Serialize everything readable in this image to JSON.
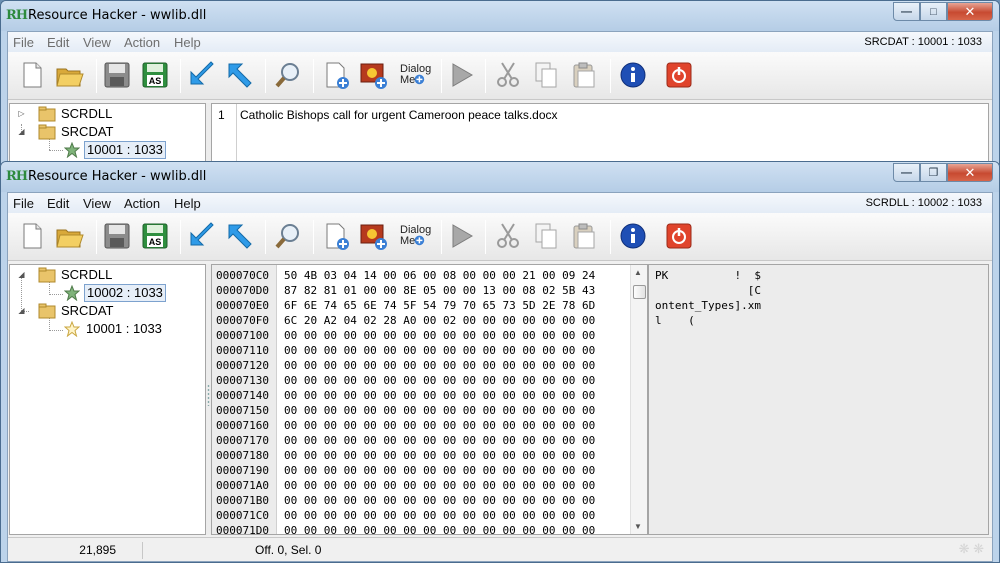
{
  "back_window": {
    "title": "Resource Hacker - wwlib.dll",
    "app_icon": "RH",
    "menus": [
      "File",
      "Edit",
      "View",
      "Action",
      "Help"
    ],
    "selection_status": "SRCDAT : 10001 : 1033",
    "tree": {
      "nodes": [
        {
          "label": "SCRDLL"
        },
        {
          "label": "SRCDAT"
        },
        {
          "label": "10001 : 1033"
        }
      ]
    },
    "editor": {
      "line_number": "1",
      "line_text": "Catholic Bishops call for urgent Cameroon peace talks.docx"
    }
  },
  "front_window": {
    "title": "Resource Hacker - wwlib.dll",
    "app_icon": "RH",
    "menus": [
      "File",
      "Edit",
      "View",
      "Action",
      "Help"
    ],
    "selection_status": "SCRDLL : 10002 : 1033",
    "toolbar": {
      "dialog_menu_label": "Dialog Mer"
    },
    "tree": {
      "nodes": [
        {
          "label": "SCRDLL"
        },
        {
          "label": "10002 : 1033"
        },
        {
          "label": "SRCDAT"
        },
        {
          "label": "10001 : 1033"
        }
      ]
    },
    "hex": {
      "rows": [
        {
          "offset": "000070C0",
          "bytes": "50 4B 03 04 14 00 06 00 08 00 00 00 21 00 09 24"
        },
        {
          "offset": "000070D0",
          "bytes": "87 82 81 01 00 00 8E 05 00 00 13 00 08 02 5B 43"
        },
        {
          "offset": "000070E0",
          "bytes": "6F 6E 74 65 6E 74 5F 54 79 70 65 73 5D 2E 78 6D"
        },
        {
          "offset": "000070F0",
          "bytes": "6C 20 A2 04 02 28 A0 00 02 00 00 00 00 00 00 00"
        },
        {
          "offset": "00007100",
          "bytes": "00 00 00 00 00 00 00 00 00 00 00 00 00 00 00 00"
        },
        {
          "offset": "00007110",
          "bytes": "00 00 00 00 00 00 00 00 00 00 00 00 00 00 00 00"
        },
        {
          "offset": "00007120",
          "bytes": "00 00 00 00 00 00 00 00 00 00 00 00 00 00 00 00"
        },
        {
          "offset": "00007130",
          "bytes": "00 00 00 00 00 00 00 00 00 00 00 00 00 00 00 00"
        },
        {
          "offset": "00007140",
          "bytes": "00 00 00 00 00 00 00 00 00 00 00 00 00 00 00 00"
        },
        {
          "offset": "00007150",
          "bytes": "00 00 00 00 00 00 00 00 00 00 00 00 00 00 00 00"
        },
        {
          "offset": "00007160",
          "bytes": "00 00 00 00 00 00 00 00 00 00 00 00 00 00 00 00"
        },
        {
          "offset": "00007170",
          "bytes": "00 00 00 00 00 00 00 00 00 00 00 00 00 00 00 00"
        },
        {
          "offset": "00007180",
          "bytes": "00 00 00 00 00 00 00 00 00 00 00 00 00 00 00 00"
        },
        {
          "offset": "00007190",
          "bytes": "00 00 00 00 00 00 00 00 00 00 00 00 00 00 00 00"
        },
        {
          "offset": "000071A0",
          "bytes": "00 00 00 00 00 00 00 00 00 00 00 00 00 00 00 00"
        },
        {
          "offset": "000071B0",
          "bytes": "00 00 00 00 00 00 00 00 00 00 00 00 00 00 00 00"
        },
        {
          "offset": "000071C0",
          "bytes": "00 00 00 00 00 00 00 00 00 00 00 00 00 00 00 00"
        },
        {
          "offset": "000071D0",
          "bytes": "00 00 00 00 00 00 00 00 00 00 00 00 00 00 00 00"
        }
      ]
    },
    "ascii": {
      "rows": [
        "PK          !  $",
        "              [C",
        "ontent_Types].xm",
        "l    ("
      ]
    },
    "status": {
      "size": "21,895",
      "offset_selection": "Off. 0, Sel. 0"
    }
  },
  "colors": {
    "frame": "#bcd3ea",
    "close_button": "#c74a31",
    "selection_border": "#7da2ce",
    "offset_column": "#ececec"
  }
}
